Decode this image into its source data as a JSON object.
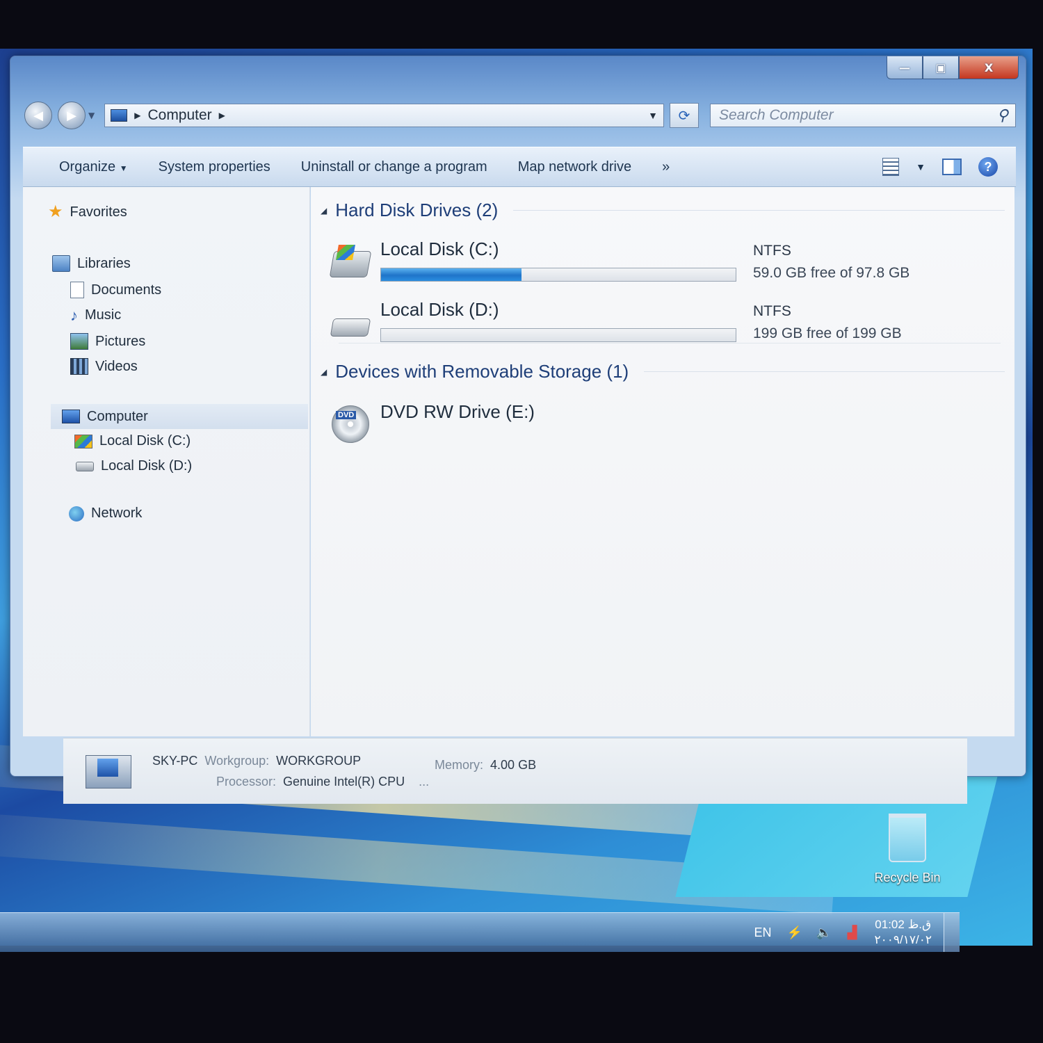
{
  "window": {
    "caption": {
      "minimize": "—",
      "maximize": "▣",
      "close": "X"
    }
  },
  "address": {
    "path": [
      "Computer"
    ],
    "refresh_glyph": "⟳"
  },
  "search": {
    "placeholder": "Search Computer"
  },
  "toolbar": {
    "organize_label": "Organize",
    "system_properties_label": "System properties",
    "uninstall_label": "Uninstall or change a program",
    "map_drive_label": "Map network drive",
    "more_label": "»",
    "help_glyph": "?"
  },
  "nav_pane": {
    "favorites": "Favorites",
    "libraries": "Libraries",
    "library_items": [
      "Documents",
      "Music",
      "Pictures",
      "Videos"
    ],
    "computer": "Computer",
    "computer_items": [
      "Local Disk (C:)",
      "Local Disk (D:)"
    ],
    "network": "Network"
  },
  "content": {
    "hard_disk_header": "Hard Disk Drives (2)",
    "drives": [
      {
        "name": "Local Disk (C:)",
        "fs": "NTFS",
        "free_text": "59.0 GB free of 97.8 GB",
        "used_fraction": 0.397
      },
      {
        "name": "Local Disk (D:)",
        "fs": "NTFS",
        "free_text": "199 GB free of 199 GB",
        "used_fraction": 0.0
      }
    ],
    "removable_header": "Devices with Removable Storage (1)",
    "removable": [
      {
        "name": "DVD RW Drive (E:)",
        "badge": "DVD"
      }
    ]
  },
  "details": {
    "pc_name": "SKY-PC",
    "workgroup_label": "Workgroup:",
    "workgroup_value": "WORKGROUP",
    "memory_label": "Memory:",
    "memory_value": "4.00 GB",
    "processor_label": "Processor:",
    "processor_value": "Genuine Intel(R) CPU",
    "processor_more": "..."
  },
  "desktop": {
    "recycle_bin_label": "Recycle Bin"
  },
  "taskbar": {
    "language": "EN",
    "time": "01:02 ق.ظ",
    "date": "۲۰۰۹/۱۷/۰۲"
  },
  "colors": {
    "progress_fill": "#1f74c9",
    "group_header": "#1e3e78",
    "close_button": "#c4361f"
  }
}
